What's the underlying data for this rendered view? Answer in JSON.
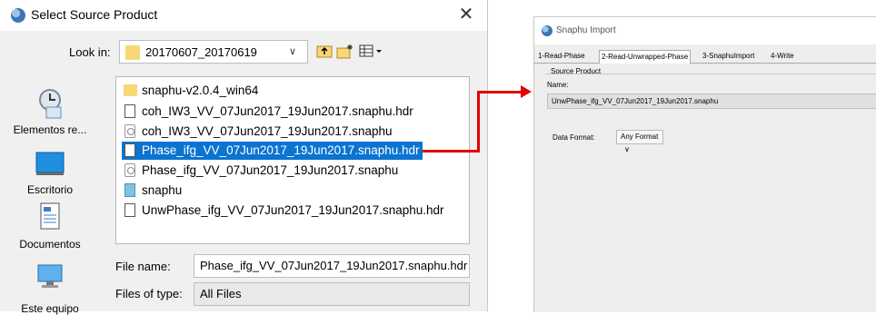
{
  "dialog": {
    "title": "Select Source Product",
    "close_glyph": "✕",
    "look_in_label": "Look in:",
    "look_in_value": "20170607_20170619",
    "chevron": "∨",
    "toolbar": {
      "up_folder_icon": "⤴",
      "new_folder_icon": "✨",
      "view_menu_icon": "▦"
    },
    "places": [
      {
        "label": "Elementos re...",
        "icon": "recent-items-icon"
      },
      {
        "label": "Escritorio",
        "icon": "desktop-icon"
      },
      {
        "label": "Documentos",
        "icon": "documents-icon"
      },
      {
        "label": "Este equipo",
        "icon": "computer-icon"
      }
    ],
    "files": [
      {
        "name": "snaphu-v2.0.4_win64",
        "icon": "folder-icon",
        "selected": false
      },
      {
        "name": "coh_IW3_VV_07Jun2017_19Jun2017.snaphu.hdr",
        "icon": "document-icon",
        "selected": false
      },
      {
        "name": "coh_IW3_VV_07Jun2017_19Jun2017.snaphu",
        "icon": "file-icon",
        "selected": false
      },
      {
        "name": "Phase_ifg_VV_07Jun2017_19Jun2017.snaphu.hdr",
        "icon": "document-icon",
        "selected": true
      },
      {
        "name": "Phase_ifg_VV_07Jun2017_19Jun2017.snaphu",
        "icon": "file-icon",
        "selected": false
      },
      {
        "name": "snaphu",
        "icon": "executable-icon",
        "selected": false
      },
      {
        "name": "UnwPhase_ifg_VV_07Jun2017_19Jun2017.snaphu.hdr",
        "icon": "document-icon",
        "selected": false
      }
    ],
    "file_name_label": "File name:",
    "file_name_value": "Phase_ifg_VV_07Jun2017_19Jun2017.snaphu.hdr",
    "files_of_type_label": "Files of type:",
    "files_of_type_value": "All Files"
  },
  "arrow_color": "#e00000",
  "snaphu": {
    "title": "Snaphu Import",
    "tabs": [
      "1-Read-Phase",
      "2-Read-Unwrapped-Phase",
      "3-SnaphuImport",
      "4-Write"
    ],
    "active_tab": 1,
    "section_label": "Source Product",
    "name_label": "Name:",
    "name_value": "UnwPhase_ifg_VV_07Jun2017_19Jun2017.snaphu",
    "format_label": "Data Format:",
    "format_value": "Any Format",
    "format_chevron": "∨"
  }
}
